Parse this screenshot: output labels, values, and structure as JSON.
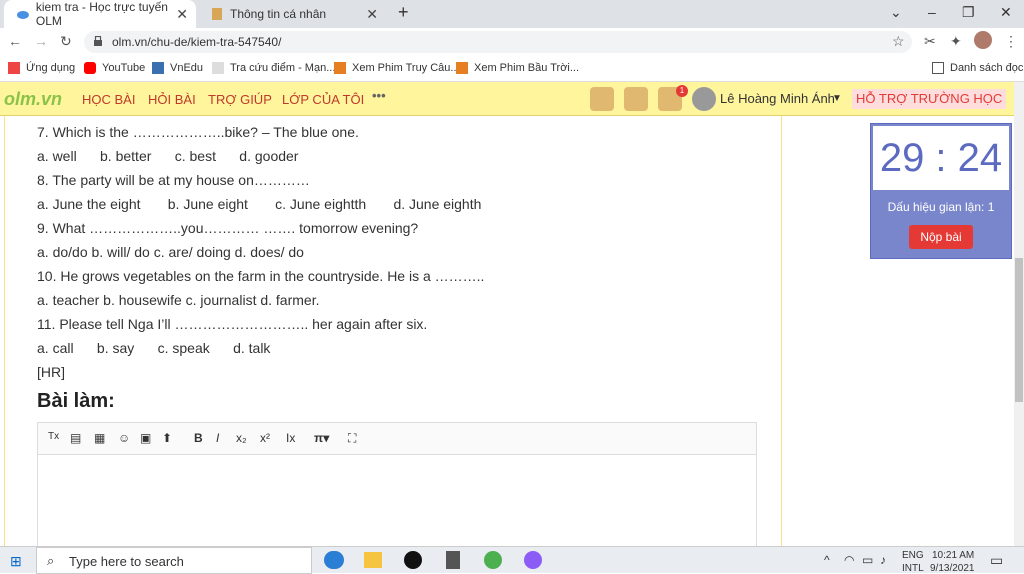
{
  "browser": {
    "tabs": [
      {
        "title": "kiem tra - Học trực tuyến OLM",
        "active": true
      },
      {
        "title": "Thông tin cá nhân",
        "active": false
      }
    ],
    "url": "olm.vn/chu-de/kiem-tra-547540/",
    "bookmarks": [
      {
        "label": "Ứng dụng",
        "icon": "apps-icon"
      },
      {
        "label": "YouTube",
        "icon": "youtube-icon"
      },
      {
        "label": "VnEdu",
        "icon": "vnedu-icon"
      },
      {
        "label": "Tra cứu điểm - Mạn...",
        "icon": "bookmark-icon"
      },
      {
        "label": "Xem Phim Truy Câu...",
        "icon": "bookmark-icon"
      },
      {
        "label": "Xem Phim Bầu Trời...",
        "icon": "bookmark-icon"
      }
    ],
    "reading_list": "Danh sách đọc"
  },
  "site": {
    "logo": "olm.vn",
    "nav": [
      "HỌC BÀI",
      "HỎI BÀI",
      "TRỢ GIÚP",
      "LỚP CỦA TÔI"
    ],
    "notification_count": "1",
    "user_name": "Lê Hoàng Minh Ánh",
    "support": "HỖ TRỢ TRƯỜNG HỌC"
  },
  "questions": [
    "7. Which is the ………………..bike? – The blue one.",
    "a. well      b. better      c. best      d. gooder",
    "8. The party will be at my house on…………",
    "a. June the eight       b. June eight       c. June eightth       d. June eighth",
    "9. What ………………..you………… ……. tomorrow evening?",
    "a. do/do b. will/ do c. are/ doing d. does/ do",
    "10. He grows vegetables on the farm in the countryside. He is a ………..",
    "a. teacher b. housewife c. journalist d. farmer.",
    "11. Please tell Nga I’ll ……………………….. her again after six.",
    "a. call      b. say      c. speak      d. talk",
    "[HR]"
  ],
  "answer_title": "Bài làm:",
  "timer": {
    "time": "29 : 24",
    "cheat_label": "Dấu hiệu gian lận: 1",
    "submit_label": "Nộp bài"
  },
  "taskbar": {
    "search_placeholder": "Type here to search",
    "lang1": "ENG",
    "lang2": "INTL",
    "time": "10:21 AM",
    "date": "9/13/2021"
  }
}
